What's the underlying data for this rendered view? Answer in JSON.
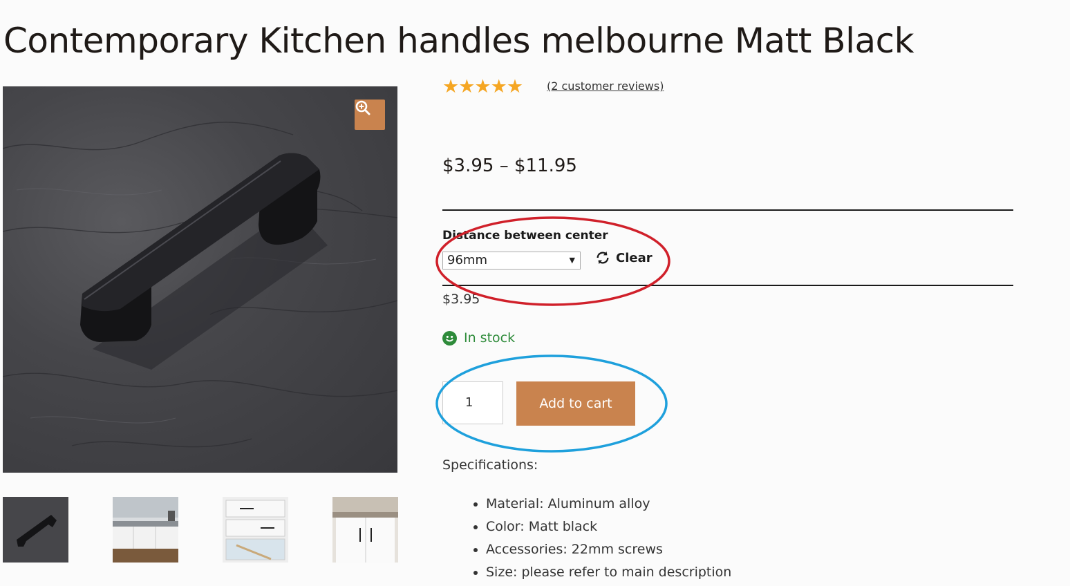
{
  "product": {
    "title": "Contemporary Kitchen handles melbourne Matt Black",
    "rating_stars": 5,
    "stars_glyphs": "★★★★★",
    "reviews_link": "(2 customer reviews)",
    "price_range": "$3.95 – $11.95"
  },
  "gallery": {
    "zoom_icon": "magnifier-plus-icon",
    "thumbnails": [
      "handle-closeup",
      "kitchen-grey",
      "drawers-open",
      "kitchen-island"
    ]
  },
  "variation": {
    "label": "Distance between center",
    "selected": "96mm",
    "clear_label": "Clear",
    "variation_price": "$3.95"
  },
  "stock": {
    "status": "In stock",
    "color": "#2e8b3a"
  },
  "cart": {
    "quantity": "1",
    "add_to_cart": "Add to cart"
  },
  "specifications": {
    "heading": "Specifications:",
    "items": [
      "Material: Aluminum alloy",
      "Color: Matt black",
      "Accessories: 22mm screws",
      "Size: please refer to main description"
    ]
  },
  "colors": {
    "accent": "#c9834e",
    "star": "#f5a623",
    "annotation_red": "#d0202a",
    "annotation_blue": "#1ea0dc"
  }
}
